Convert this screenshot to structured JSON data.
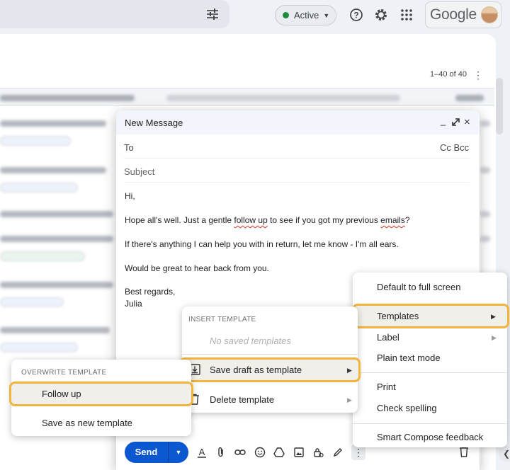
{
  "topbar": {
    "status": "Active",
    "brand": "Google"
  },
  "inbox": {
    "page_count": "1–40 of 40"
  },
  "compose": {
    "title": "New Message",
    "to_label": "To",
    "cc_bcc": "Cc Bcc",
    "subject_placeholder": "Subject",
    "body": {
      "greeting": "Hi,",
      "line1_a": "Hope all's well. Just a gentle ",
      "line1_b": "follow up",
      "line1_c": " to see if you got my previous ",
      "line1_d": "emails",
      "line1_e": "?",
      "line2": "If there's anything I can help you with in return, let me know - I'm all ears.",
      "line3": "Would be great to hear back from you.",
      "signoff": "Best regards,",
      "name": "Julia"
    },
    "send_label": "Send"
  },
  "more_menu": {
    "items": [
      "Default to full screen",
      "Templates",
      "Label",
      "Plain text mode",
      "Print",
      "Check spelling",
      "Smart Compose feedback"
    ]
  },
  "templates_menu": {
    "section": "INSERT TEMPLATE",
    "empty": "No saved templates",
    "save_draft": "Save draft as template",
    "delete": "Delete template"
  },
  "overwrite_menu": {
    "section": "OVERWRITE TEMPLATE",
    "follow_up": "Follow up",
    "save_new": "Save as new template"
  }
}
